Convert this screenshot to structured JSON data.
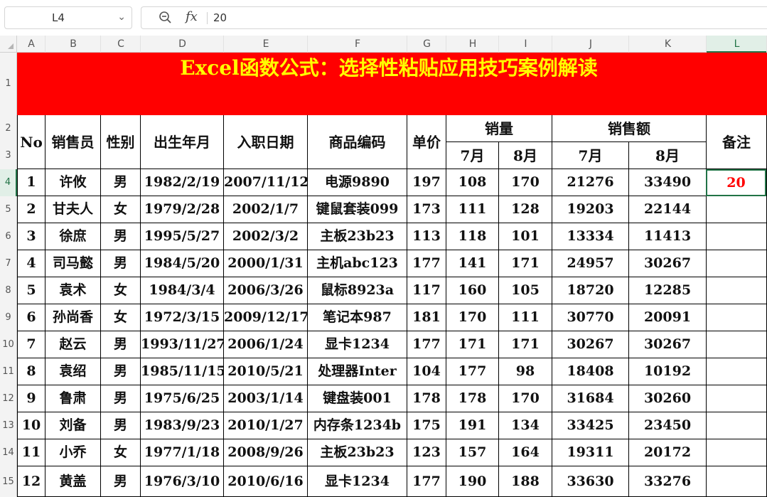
{
  "formula_bar": {
    "name_box": "L4",
    "fx_label": "fx",
    "formula_value": "20"
  },
  "columns": [
    "A",
    "B",
    "C",
    "D",
    "E",
    "F",
    "G",
    "H",
    "I",
    "J",
    "K",
    "L"
  ],
  "rows": [
    "1",
    "2",
    "3",
    "4",
    "5",
    "6",
    "7",
    "8",
    "9",
    "10",
    "11",
    "12",
    "13",
    "14",
    "15"
  ],
  "title": "Excel函数公式：选择性粘贴应用技巧案例解读",
  "headers": {
    "no": "No",
    "salesperson": "销售员",
    "gender": "性别",
    "birth": "出生年月",
    "hire": "入职日期",
    "product_code": "商品编码",
    "unit_price": "单价",
    "sales_qty": "销量",
    "sales_amount": "销售额",
    "july": "7月",
    "august": "8月",
    "notes": "备注"
  },
  "records": [
    [
      "1",
      "许攸",
      "男",
      "1982/2/19",
      "2007/11/12",
      "电源9890",
      "197",
      "108",
      "170",
      "21276",
      "33490"
    ],
    [
      "2",
      "甘夫人",
      "女",
      "1979/2/28",
      "2002/1/7",
      "键鼠套装099",
      "173",
      "111",
      "128",
      "19203",
      "22144"
    ],
    [
      "3",
      "徐庶",
      "男",
      "1995/5/27",
      "2002/3/2",
      "主板23b23",
      "113",
      "118",
      "101",
      "13334",
      "11413"
    ],
    [
      "4",
      "司马懿",
      "男",
      "1984/5/20",
      "2000/1/31",
      "主机abc123",
      "177",
      "141",
      "171",
      "24957",
      "30267"
    ],
    [
      "5",
      "袁术",
      "女",
      "1984/3/4",
      "2006/3/26",
      "鼠标8923a",
      "117",
      "160",
      "105",
      "18720",
      "12285"
    ],
    [
      "6",
      "孙尚香",
      "女",
      "1972/3/15",
      "2009/12/17",
      "笔记本987",
      "181",
      "170",
      "111",
      "30770",
      "20091"
    ],
    [
      "7",
      "赵云",
      "男",
      "1993/11/27",
      "2006/1/24",
      "显卡1234",
      "177",
      "171",
      "171",
      "30267",
      "30267"
    ],
    [
      "8",
      "袁绍",
      "男",
      "1985/11/15",
      "2010/5/21",
      "处理器Inter",
      "104",
      "177",
      "98",
      "18408",
      "10192"
    ],
    [
      "9",
      "鲁肃",
      "男",
      "1975/6/25",
      "2003/1/14",
      "键盘装001",
      "178",
      "178",
      "170",
      "31684",
      "30260"
    ],
    [
      "10",
      "刘备",
      "男",
      "1983/9/23",
      "2010/1/27",
      "内存条1234b",
      "175",
      "191",
      "134",
      "33425",
      "23450"
    ],
    [
      "11",
      "小乔",
      "女",
      "1977/1/18",
      "2008/9/26",
      "主板23b23",
      "123",
      "157",
      "164",
      "19311",
      "20172"
    ],
    [
      "12",
      "黄盖",
      "男",
      "1976/3/10",
      "2010/6/16",
      "显卡1234",
      "177",
      "190",
      "188",
      "33630",
      "33276"
    ]
  ],
  "active_cell_value": "20",
  "colors": {
    "title_bg": "#ff0000",
    "title_text": "#ffff00",
    "selection": "#217346"
  }
}
